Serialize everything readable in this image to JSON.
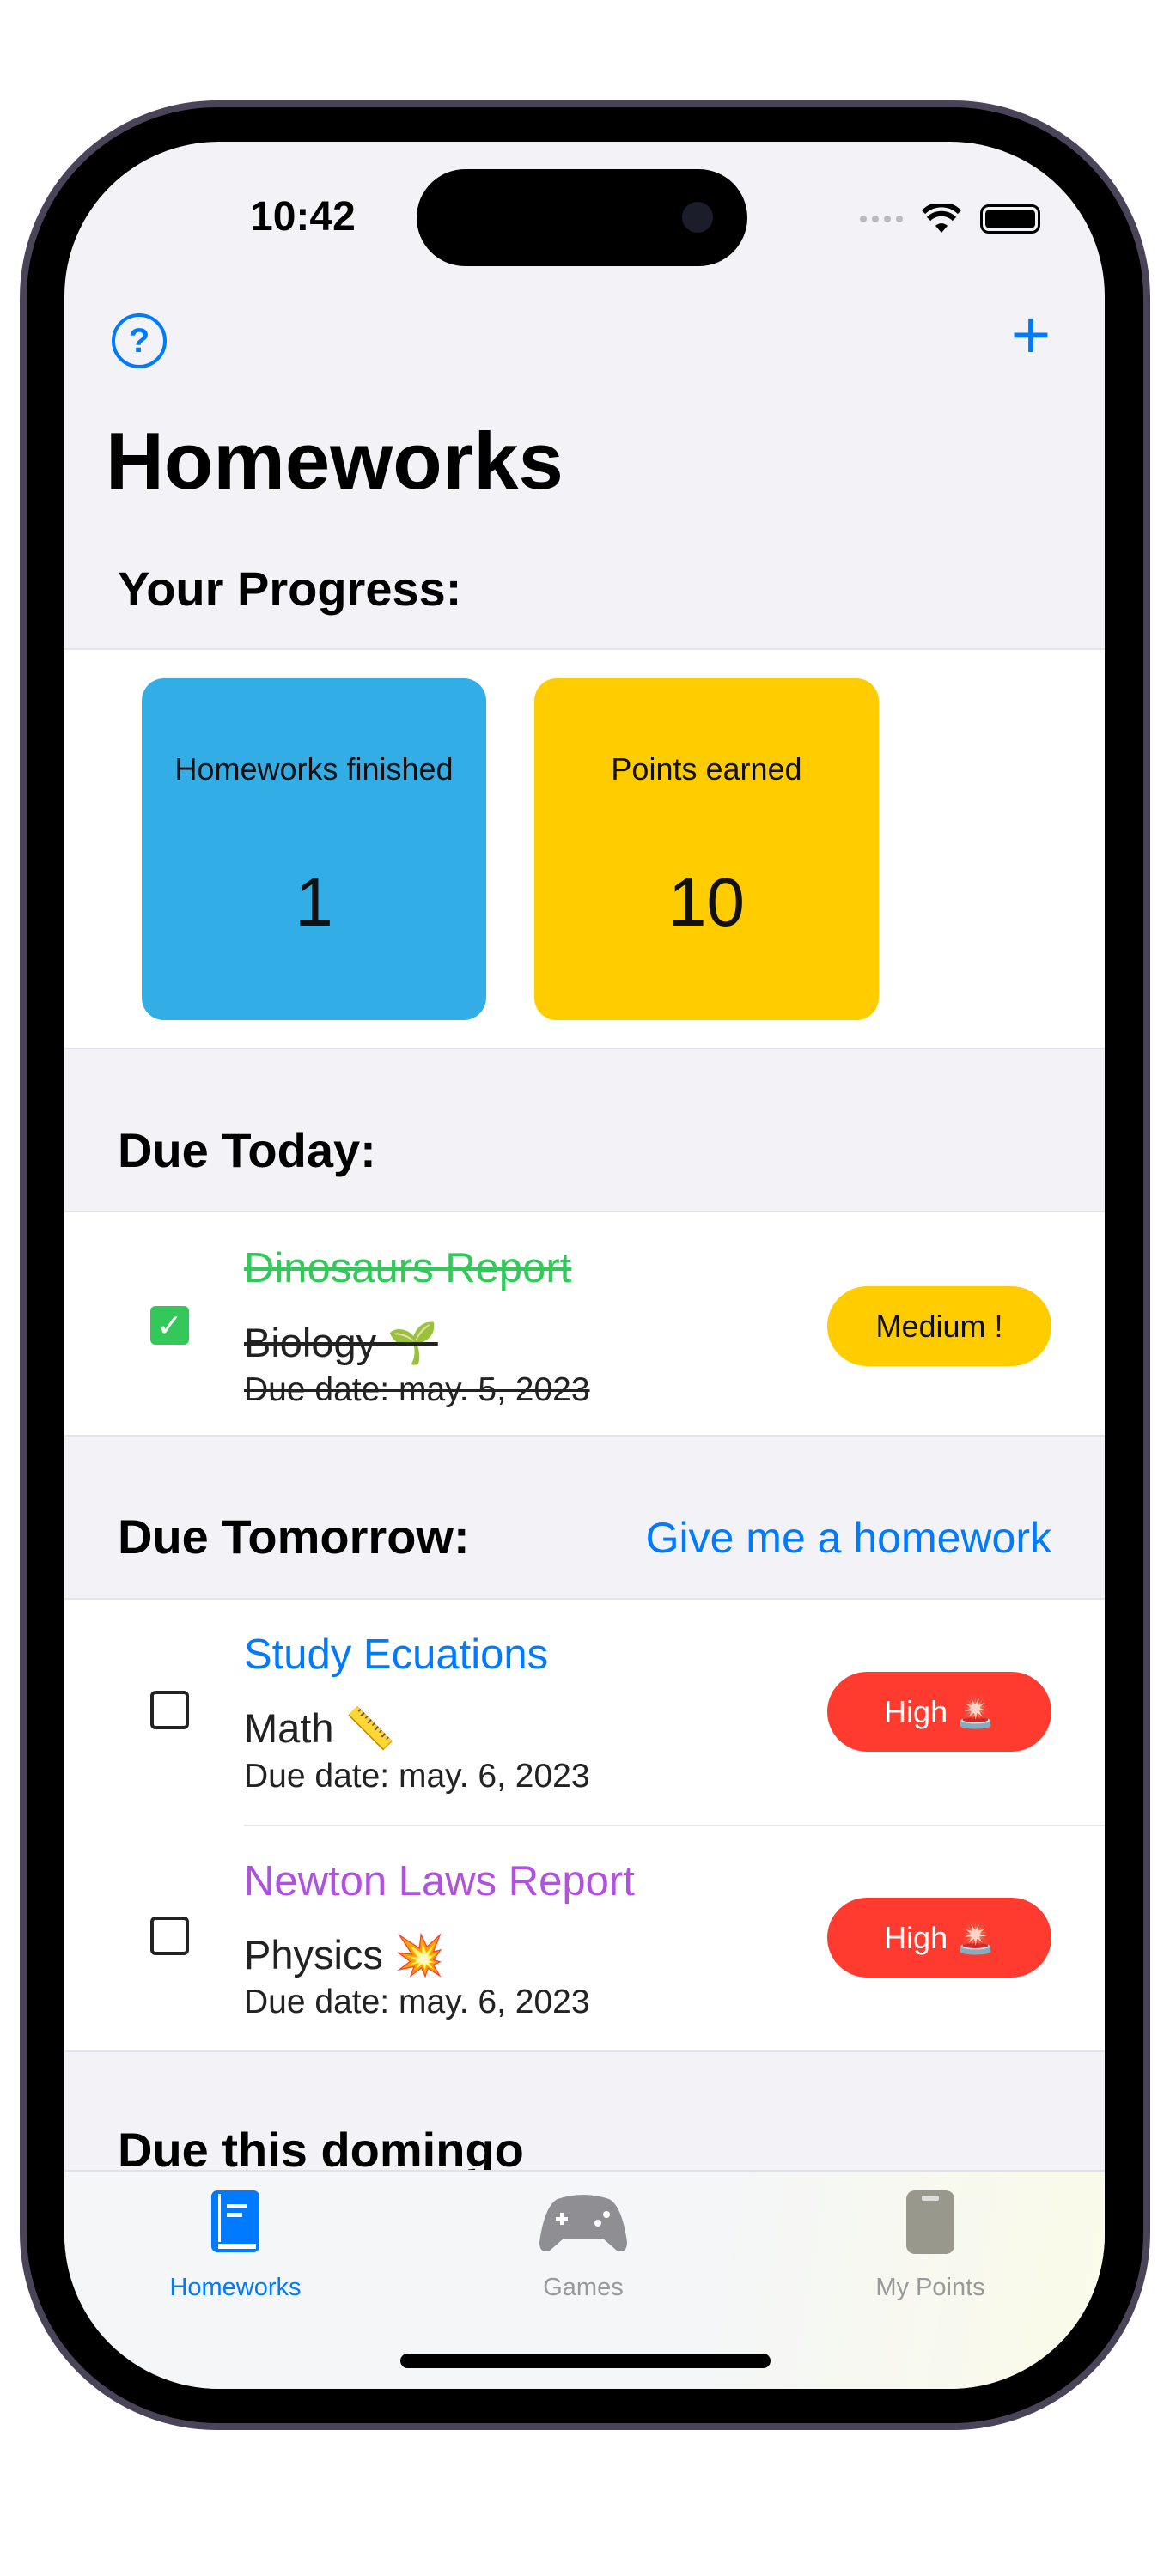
{
  "status_bar": {
    "time": "10:42"
  },
  "nav": {
    "help_icon": "question-circle-icon",
    "add_icon": "plus-icon",
    "help_glyph": "?",
    "add_glyph": "+"
  },
  "title": "Homeworks",
  "progress": {
    "heading": "Your Progress:",
    "cards": [
      {
        "label": "Homeworks finished",
        "value": "1",
        "color": "#32ade6"
      },
      {
        "label": "Points earned",
        "value": "10",
        "color": "#ffcc00"
      }
    ]
  },
  "due_today": {
    "heading": "Due Today:",
    "items": [
      {
        "title": "Dinosaurs Report",
        "subject": "Biology 🌱",
        "due": "Due date: may. 5, 2023",
        "priority": "Medium  !",
        "done": true,
        "title_color": "#34c759",
        "badge_color": "#ffcc00"
      }
    ]
  },
  "due_tomorrow": {
    "heading": "Due Tomorrow:",
    "link": "Give me a homework",
    "items": [
      {
        "title": "Study Ecuations",
        "subject": "Math 📏",
        "due": "Due date: may. 6, 2023",
        "priority": "High 🚨",
        "done": false,
        "title_color": "#007aff",
        "badge_color": "#ff3b30"
      },
      {
        "title": "Newton Laws Report",
        "subject": "Physics 💥",
        "due": "Due date: may. 6, 2023",
        "priority": "High 🚨",
        "done": false,
        "title_color": "#af52de",
        "badge_color": "#ff3b30"
      }
    ]
  },
  "due_weekday": {
    "heading": "Due this domingo"
  },
  "tabs": [
    {
      "label": "Homeworks",
      "icon": "book-icon",
      "active": true
    },
    {
      "label": "Games",
      "icon": "gamecontroller-icon",
      "active": false
    },
    {
      "label": "My Points",
      "icon": "phone-icon",
      "active": false
    }
  ],
  "colors": {
    "accent": "#007aff",
    "background": "#f2f2f7",
    "inactive": "#999999"
  }
}
